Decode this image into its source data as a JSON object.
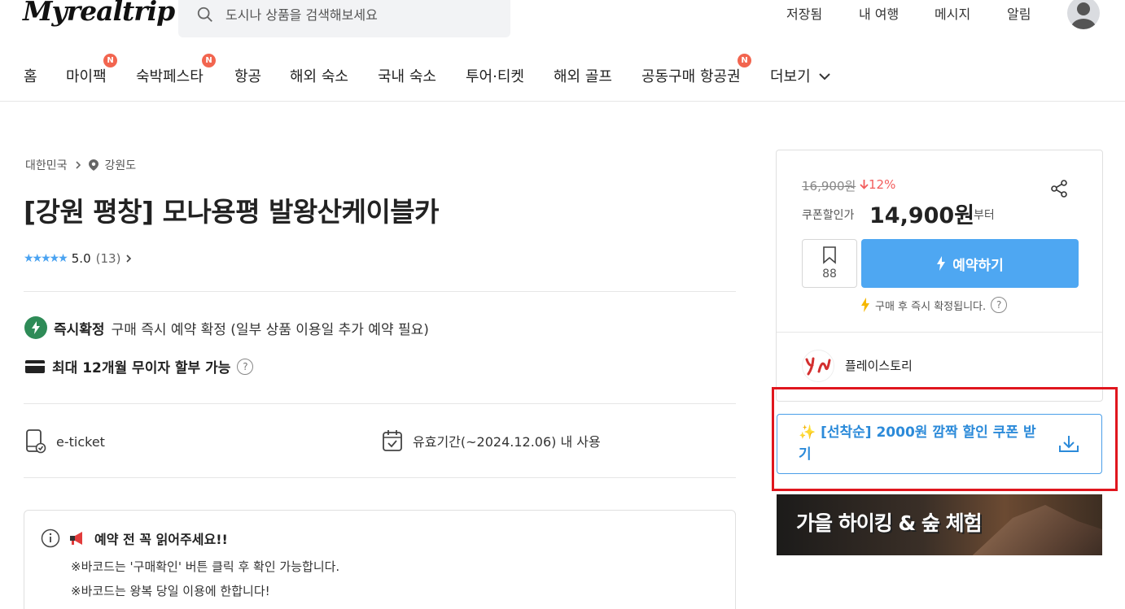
{
  "header": {
    "logo": "Myrealtrip",
    "search_placeholder": "도시나 상품을 검색해보세요",
    "nav": [
      "저장됨",
      "내 여행",
      "메시지",
      "알림"
    ]
  },
  "categories": {
    "items": [
      "홈",
      "마이팩",
      "숙박페스타",
      "항공",
      "해외 숙소",
      "국내 숙소",
      "투어·티켓",
      "해외 골프",
      "공동구매 항공권",
      "더보기"
    ],
    "badge": "N"
  },
  "product": {
    "breadcrumb": [
      "대한민국",
      "강원도"
    ],
    "title": "[강원 평창] 모나용평 발왕산케이블카",
    "stars": "★★★★★",
    "rating": "5.0",
    "review_count": "(13)",
    "instant_label": "즉시확정",
    "instant_desc": "구매 즉시 예약 확정 (일부 상품 이용일 추가 예약 필요)",
    "installment": "최대 12개월 무이자 할부 가능",
    "ticket_type": "e-ticket",
    "validity": "유효기간(~2024.12.06) 내 사용"
  },
  "notice": {
    "title": "예약 전 꼭 읽어주세요!!",
    "lines": [
      "※바코드는 '구매확인' 버튼 클릭 후 확인 가능합니다.",
      "※바코드는 왕복 당일 이용에 한합니다!"
    ]
  },
  "price_card": {
    "original_price": "16,900원",
    "discount": "12%",
    "coupon_label": "쿠폰할인가",
    "price": "14,900원",
    "from": "부터",
    "wish_count": "88",
    "book_label": "예약하기",
    "confirm_text": "구매 후 즉시 확정됩니다.",
    "seller": "플레이스토리"
  },
  "coupon": {
    "emoji": "✨",
    "text": "[선착순] 2000원 깜짝 할인 쿠폰 받기"
  },
  "banner": {
    "text": "가을 하이킹 & 숲 체험"
  },
  "colors": {
    "accent": "#4ea7f2",
    "discount": "#f25c5c",
    "badge": "#f2654f",
    "highlight_box": "#e0161e"
  }
}
